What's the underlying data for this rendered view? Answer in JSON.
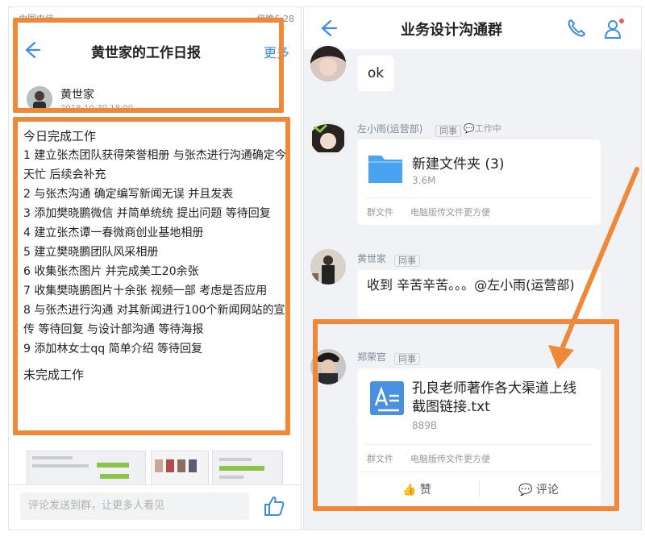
{
  "left": {
    "status_carrier": "中国电信",
    "status_time": "傍晚6:28",
    "title": "黄世家的工作日报",
    "more": "更多",
    "author": "黄世家",
    "date": "2018-10-30 18:00",
    "heading_done": "今日完成工作",
    "items": [
      "1 建立张杰团队获得荣誉相册 与张杰进行沟通确定今天忙 后续会补充",
      "2 与张杰沟通 确定编写新闻无误 并且发表",
      "3 添加樊晓鹏微信 并简单统统 提出问题 等待回复",
      "4 建立张杰谭一春微商创业基地相册",
      "5 建立樊晓鹏团队风采相册",
      "6 收集张杰图片 并完成美工20余张",
      "7 收集樊晓鹏图片十余张 视频一部 考虑是否应用",
      "8 与张杰进行沟通 对其新闻进行100个新闻网站的宣传 等待回复 与设计部沟通 等待海报",
      "9 添加林女士qq 简单介绍 等待回复"
    ],
    "heading_undone": "未完成工作",
    "comment_placeholder": "评论发送到群，让更多人看见"
  },
  "right": {
    "title": "业务设计沟通群",
    "messages": [
      {
        "text": "ok"
      },
      {
        "sender": "左小雨(运营部)",
        "tag": "同事",
        "status": "工作中",
        "file_name": "新建文件夹 (3)",
        "file_size": "3.6M",
        "footer_a": "群文件",
        "footer_b": "电脑版传文件更方便"
      },
      {
        "sender": "黄世家",
        "tag": "同事",
        "text": "收到 辛苦辛苦。。。@左小雨(运营部)"
      },
      {
        "sender": "郑荣官",
        "tag": "同事",
        "file_name": "孔良老师著作各大渠道上线截图链接.txt",
        "file_size": "889B",
        "footer_a": "群文件",
        "footer_b": "电脑版传文件更方便",
        "like": "赞",
        "comment": "评论"
      }
    ]
  },
  "colors": {
    "annotation": "#f0883a",
    "link": "#3a8ee6",
    "folder": "#4aa3f0"
  }
}
